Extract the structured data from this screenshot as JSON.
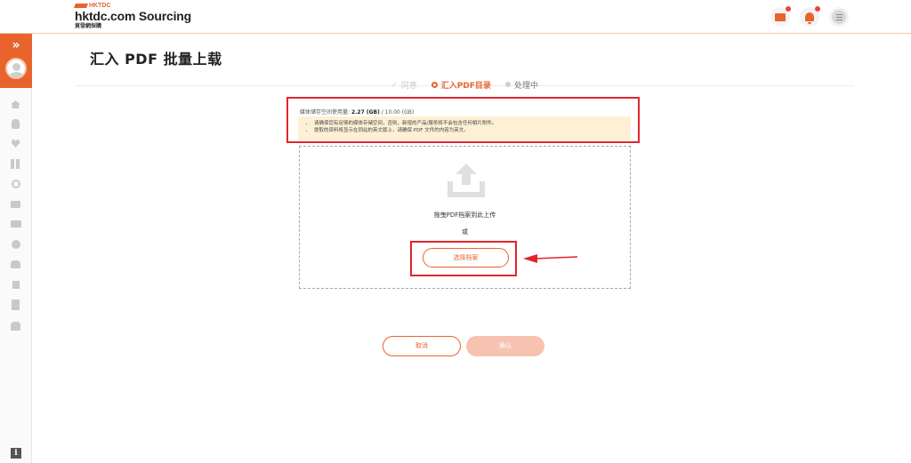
{
  "header": {
    "logo_small": "HKTDC",
    "logo_main": "hktdc.com Sourcing",
    "logo_sub": "貿發網採購",
    "icons": [
      "mail-icon",
      "bell-icon",
      "menu-icon"
    ],
    "accent_color": "#e8642c",
    "badge_color": "#e9453a"
  },
  "sidebar": {
    "expand_glyph": "»",
    "icons": [
      "home-icon",
      "user-icon",
      "heart-icon",
      "grid-icon",
      "history-icon",
      "message-icon",
      "card-icon",
      "cube-icon",
      "user-edit-icon",
      "archive-icon",
      "building-icon",
      "team-icon"
    ],
    "info_label": "i"
  },
  "page": {
    "title": "汇入 PDF 批量上载"
  },
  "steps": [
    {
      "label": "同意",
      "state": "done"
    },
    {
      "label": "汇入PDF目录",
      "state": "active"
    },
    {
      "label": "处理中",
      "state": "pending"
    }
  ],
  "storage": {
    "prefix": "媒体储存空间使用量:",
    "used": "2.27 (GB)",
    "total": "/ 10.00 (GB)"
  },
  "notice": {
    "lines": [
      "请确保您有足够的媒体存储空间，否则，新增的产品/服务将不会包含任何相片附件。",
      "提取的资料将显示在同站的英文版上，请确保 PDF 文件的内容为英文。"
    ]
  },
  "dropzone": {
    "drag_text": "拖曳PDF档案到此上传",
    "or_text": "或",
    "choose_label": "选择档案"
  },
  "actions": {
    "cancel_label": "取消",
    "confirm_label": "确认"
  }
}
